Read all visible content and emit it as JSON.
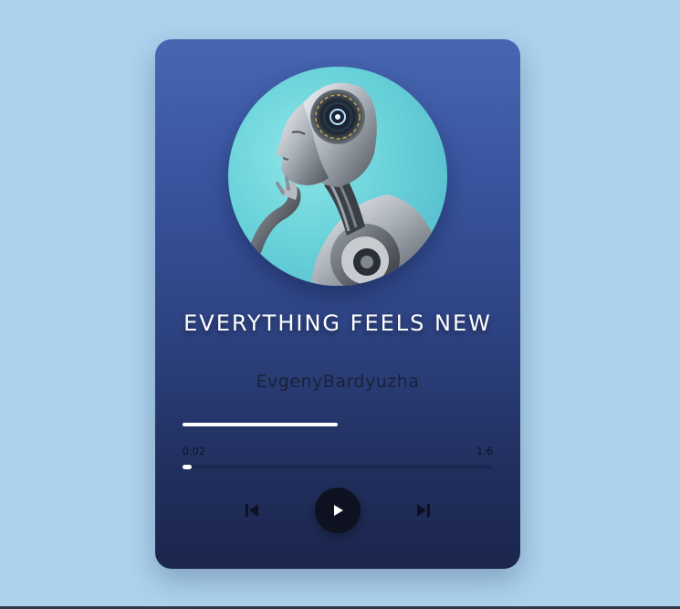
{
  "track": {
    "title": "EVERYTHING FEELS NEW",
    "artist": "EvgenyBardyuzha",
    "artwork_icon": "robot-portrait-icon"
  },
  "playback": {
    "elapsed": "0:02",
    "duration": "1:6",
    "progress_fraction": 0.03,
    "volume_fraction": 0.5
  },
  "controls": {
    "previous_icon": "skip-previous-icon",
    "play_icon": "play-icon",
    "next_icon": "skip-next-icon"
  },
  "colors": {
    "page_background": "#acd2ec",
    "card_top": "#4766b1",
    "card_bottom": "#1b264e",
    "play_button": "#0e1220"
  }
}
